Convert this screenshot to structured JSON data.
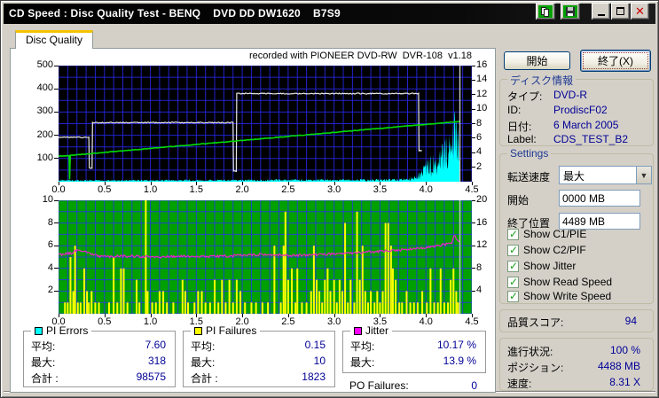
{
  "window": {
    "title": "CD Speed : Disc Quality Test - BENQ    DVD DD DW1620    B7S9",
    "titlebar_icons": [
      "copy-icon",
      "save-icon",
      "minimize-icon",
      "maximize-icon",
      "close-icon"
    ]
  },
  "tab": {
    "label": "Disc Quality"
  },
  "chart_data": [
    {
      "type": "line",
      "title": "recorded with PIONEER DVD-RW  DVR-108  v1.18",
      "x_range": [
        0,
        4.5
      ],
      "left_axis": {
        "range": [
          0,
          500
        ],
        "ticks": [
          [
            100,
            "100"
          ],
          [
            200,
            "200"
          ],
          [
            300,
            "300"
          ],
          [
            400,
            "400"
          ],
          [
            500,
            "500"
          ]
        ]
      },
      "right_axis": {
        "range": [
          0,
          16
        ],
        "ticks": [
          [
            2,
            "2"
          ],
          [
            4,
            "4"
          ],
          [
            6,
            "6"
          ],
          [
            8,
            "8"
          ],
          [
            10,
            "10"
          ],
          [
            12,
            "12"
          ],
          [
            14,
            "14"
          ],
          [
            16,
            "16"
          ]
        ]
      },
      "x_ticks": [
        [
          0,
          "0.0"
        ],
        [
          0.5,
          "0.5"
        ],
        [
          1,
          "1.0"
        ],
        [
          1.5,
          "1.5"
        ],
        [
          2,
          "2.0"
        ],
        [
          2.5,
          "2.5"
        ],
        [
          3,
          "3.0"
        ],
        [
          3.5,
          "3.5"
        ],
        [
          4,
          "4.0"
        ],
        [
          4.5,
          "4.5"
        ]
      ],
      "grid": {
        "x_step": 0.1,
        "y_step": 50,
        "color": "#2222CC"
      },
      "background": "#000000",
      "series": [
        {
          "name": "pi-errors",
          "type": "spiky-area",
          "axis": "left",
          "color": "#00FFFF",
          "points": [
            [
              0,
              8
            ],
            [
              0.5,
              7
            ],
            [
              1.0,
              7
            ],
            [
              1.5,
              8
            ],
            [
              2.0,
              8
            ],
            [
              2.5,
              9
            ],
            [
              3.0,
              9
            ],
            [
              3.5,
              10
            ],
            [
              3.8,
              12
            ],
            [
              3.9,
              25
            ],
            [
              3.95,
              55
            ],
            [
              4.0,
              75
            ],
            [
              4.05,
              90
            ],
            [
              4.1,
              110
            ],
            [
              4.15,
              130
            ],
            [
              4.2,
              150
            ],
            [
              4.25,
              175
            ],
            [
              4.3,
              210
            ],
            [
              4.33,
              318
            ],
            [
              4.35,
              230
            ],
            [
              4.37,
              90
            ]
          ]
        },
        {
          "name": "write-speed",
          "type": "line",
          "axis": "right",
          "color": "#E8E8E8",
          "width": 1.2,
          "noise": 0.07,
          "points": [
            [
              0,
              6.1
            ],
            [
              0.33,
              6.1
            ],
            [
              0.335,
              1.9
            ],
            [
              0.365,
              1.9
            ],
            [
              0.37,
              8.15
            ],
            [
              1.9,
              8.15
            ],
            [
              1.905,
              1.45
            ],
            [
              1.935,
              1.45
            ],
            [
              1.94,
              12.15
            ],
            [
              3.92,
              12.15
            ],
            [
              3.925,
              4.3
            ],
            [
              3.955,
              4.3
            ]
          ]
        },
        {
          "name": "read-speed",
          "type": "line",
          "axis": "right",
          "color": "#00DC00",
          "width": 1.6,
          "noise": 0.04,
          "points": [
            [
              0,
              3.55
            ],
            [
              0.115,
              3.58
            ],
            [
              0.12,
              0.3
            ],
            [
              0.128,
              3.62
            ],
            [
              4.37,
              8.31
            ]
          ]
        },
        {
          "name": "end-marker",
          "type": "line",
          "axis": "right",
          "color": "#C8C8C8",
          "width": 1.4,
          "noise": 0,
          "points": [
            [
              4.37,
              0
            ],
            [
              4.37,
              16
            ]
          ]
        }
      ]
    },
    {
      "type": "bar",
      "title": "",
      "x_range": [
        0,
        4.5
      ],
      "left_axis": {
        "range": [
          0,
          10
        ],
        "ticks": [
          [
            2,
            "2"
          ],
          [
            4,
            "4"
          ],
          [
            6,
            "6"
          ],
          [
            8,
            "8"
          ],
          [
            10,
            "10"
          ]
        ]
      },
      "right_axis": {
        "range": [
          0,
          20
        ],
        "ticks": [
          [
            4,
            "4"
          ],
          [
            8,
            "8"
          ],
          [
            12,
            "12"
          ],
          [
            16,
            "16"
          ],
          [
            20,
            "20"
          ]
        ]
      },
      "x_ticks": [
        [
          0,
          "0.0"
        ],
        [
          0.5,
          "0.5"
        ],
        [
          1,
          "1.0"
        ],
        [
          1.5,
          "1.5"
        ],
        [
          2,
          "2.0"
        ],
        [
          2.5,
          "2.5"
        ],
        [
          3,
          "3.0"
        ],
        [
          3.5,
          "3.5"
        ],
        [
          4,
          "4.0"
        ],
        [
          4.5,
          "4.5"
        ]
      ],
      "grid": {
        "x_step": 0.1,
        "y_step": 1,
        "color": "#2244CC"
      },
      "background": "#00A000",
      "series": [
        {
          "name": "pi-failures",
          "type": "bars",
          "axis": "left",
          "color": "#FFFF00",
          "points": [
            [
              0.07,
              1
            ],
            [
              0.1,
              1
            ],
            [
              0.13,
              5
            ],
            [
              0.16,
              2
            ],
            [
              0.18,
              6
            ],
            [
              0.21,
              1
            ],
            [
              0.24,
              1
            ],
            [
              0.28,
              4
            ],
            [
              0.31,
              2
            ],
            [
              0.33,
              1
            ],
            [
              0.36,
              2
            ],
            [
              0.4,
              1
            ],
            [
              0.44,
              1
            ],
            [
              0.55,
              1
            ],
            [
              0.6,
              5
            ],
            [
              0.64,
              1
            ],
            [
              0.68,
              4
            ],
            [
              0.71,
              4
            ],
            [
              0.75,
              1
            ],
            [
              0.85,
              3
            ],
            [
              0.88,
              1
            ],
            [
              0.95,
              10
            ],
            [
              0.97,
              2
            ],
            [
              1.02,
              1
            ],
            [
              1.06,
              1
            ],
            [
              1.1,
              2
            ],
            [
              1.14,
              2
            ],
            [
              1.18,
              1
            ],
            [
              1.25,
              1
            ],
            [
              1.35,
              3
            ],
            [
              1.38,
              2
            ],
            [
              1.41,
              1
            ],
            [
              1.48,
              1
            ],
            [
              1.52,
              2
            ],
            [
              1.56,
              2
            ],
            [
              1.6,
              1
            ],
            [
              1.65,
              1
            ],
            [
              1.7,
              3
            ],
            [
              1.74,
              1
            ],
            [
              1.78,
              3
            ],
            [
              1.82,
              1
            ],
            [
              1.86,
              3
            ],
            [
              1.9,
              1
            ],
            [
              1.94,
              3
            ],
            [
              1.98,
              2
            ],
            [
              2.03,
              1
            ],
            [
              2.1,
              1
            ],
            [
              2.15,
              1
            ],
            [
              2.22,
              1
            ],
            [
              2.28,
              1
            ],
            [
              2.35,
              6
            ],
            [
              2.42,
              1
            ],
            [
              2.45,
              6
            ],
            [
              2.47,
              9
            ],
            [
              2.5,
              3
            ],
            [
              2.54,
              4
            ],
            [
              2.58,
              1
            ],
            [
              2.6,
              4
            ],
            [
              2.65,
              1
            ],
            [
              2.7,
              1
            ],
            [
              2.75,
              2
            ],
            [
              2.78,
              6
            ],
            [
              2.81,
              3
            ],
            [
              2.84,
              2
            ],
            [
              2.87,
              1
            ],
            [
              2.9,
              3
            ],
            [
              2.93,
              4
            ],
            [
              2.96,
              2
            ],
            [
              3.0,
              3
            ],
            [
              3.03,
              1
            ],
            [
              3.06,
              3
            ],
            [
              3.09,
              2
            ],
            [
              3.12,
              8
            ],
            [
              3.15,
              1
            ],
            [
              3.18,
              3
            ],
            [
              3.22,
              1
            ],
            [
              3.25,
              9
            ],
            [
              3.28,
              3
            ],
            [
              3.31,
              6
            ],
            [
              3.34,
              2
            ],
            [
              3.37,
              1
            ],
            [
              3.4,
              2
            ],
            [
              3.44,
              1
            ],
            [
              3.47,
              2
            ],
            [
              3.5,
              1
            ],
            [
              3.53,
              2
            ],
            [
              3.56,
              8
            ],
            [
              3.59,
              8
            ],
            [
              3.62,
              6
            ],
            [
              3.64,
              4
            ],
            [
              3.67,
              3
            ],
            [
              3.71,
              1
            ],
            [
              3.74,
              1
            ],
            [
              3.79,
              2
            ],
            [
              3.83,
              1
            ],
            [
              3.87,
              1
            ],
            [
              3.91,
              1
            ],
            [
              3.96,
              2
            ],
            [
              4.01,
              1
            ],
            [
              4.05,
              4
            ],
            [
              4.09,
              1
            ],
            [
              4.13,
              1
            ],
            [
              4.16,
              4
            ],
            [
              4.2,
              1
            ],
            [
              4.24,
              1
            ],
            [
              4.27,
              3
            ],
            [
              4.3,
              4
            ],
            [
              4.33,
              2
            ],
            [
              4.35,
              1
            ]
          ]
        },
        {
          "name": "jitter",
          "type": "line",
          "axis": "right",
          "color": "#EE22CC",
          "width": 1.2,
          "noise": 0.22,
          "points": [
            [
              0,
              10.4
            ],
            [
              0.15,
              10.7
            ],
            [
              0.2,
              11.2
            ],
            [
              0.3,
              10.9
            ],
            [
              0.45,
              10.1
            ],
            [
              0.7,
              10.15
            ],
            [
              1.0,
              10.05
            ],
            [
              1.3,
              10.1
            ],
            [
              1.6,
              10.1
            ],
            [
              1.9,
              10.2
            ],
            [
              2.2,
              10.45
            ],
            [
              2.5,
              10.3
            ],
            [
              2.8,
              10.4
            ],
            [
              3.1,
              10.6
            ],
            [
              3.4,
              10.9
            ],
            [
              3.7,
              11.2
            ],
            [
              3.95,
              11.6
            ],
            [
              4.1,
              11.9
            ],
            [
              4.2,
              12.2
            ],
            [
              4.28,
              12.4
            ],
            [
              4.31,
              13.9
            ],
            [
              4.34,
              12.9
            ],
            [
              4.37,
              12.6
            ]
          ]
        },
        {
          "name": "end-marker",
          "type": "line",
          "axis": "right",
          "color": "#C8C8C8",
          "width": 1.4,
          "noise": 0,
          "points": [
            [
              4.37,
              0
            ],
            [
              4.37,
              20
            ]
          ]
        }
      ]
    }
  ],
  "stats": {
    "pi_errors": {
      "legend": "PI Errors",
      "color": "#00FFFF",
      "rows": [
        {
          "label": "平均:",
          "value": "7.60"
        },
        {
          "label": "最大:",
          "value": "318"
        },
        {
          "label": "合計 :",
          "value": "98575"
        }
      ]
    },
    "pi_failures": {
      "legend": "PI Failures",
      "color": "#FFFF00",
      "rows": [
        {
          "label": "平均:",
          "value": "0.15"
        },
        {
          "label": "最大:",
          "value": "10"
        },
        {
          "label": "合計 :",
          "value": "1823"
        }
      ]
    },
    "jitter": {
      "legend": "Jitter",
      "color": "#FF00FF",
      "rows": [
        {
          "label": "平均:",
          "value": "10.17 %"
        },
        {
          "label": "最大:",
          "value": "13.9 %"
        }
      ]
    },
    "po_failures": {
      "label": "PO Failures:",
      "value": "0"
    }
  },
  "panel": {
    "start_button": "開始",
    "exit_button": "終了(X)",
    "disc_info": {
      "legend": "ディスク情報",
      "rows": [
        {
          "label": "タイプ:",
          "value": "DVD-R"
        },
        {
          "label": "ID:",
          "value": "ProdiscF02"
        },
        {
          "label": "日付:",
          "value": "6 March 2005"
        },
        {
          "label": "Label:",
          "value": "CDS_TEST_B2"
        }
      ]
    },
    "settings": {
      "legend": "Settings",
      "speed_label": "転送速度",
      "speed_value": "最大",
      "start_label": "開始",
      "start_value": "0000 MB",
      "end_label": "終了位置",
      "end_value": "4489 MB",
      "checkboxes": [
        "Show C1/PIE",
        "Show C2/PIF",
        "Show Jitter",
        "Show Read Speed",
        "Show Write Speed"
      ]
    },
    "score": {
      "label": "品質スコア:",
      "value": "94"
    },
    "progress": {
      "rows": [
        {
          "label": "進行状況:",
          "value": "100 %"
        },
        {
          "label": "ポジション:",
          "value": "4488 MB"
        },
        {
          "label": "速度:",
          "value": "8.31 X"
        }
      ]
    }
  }
}
